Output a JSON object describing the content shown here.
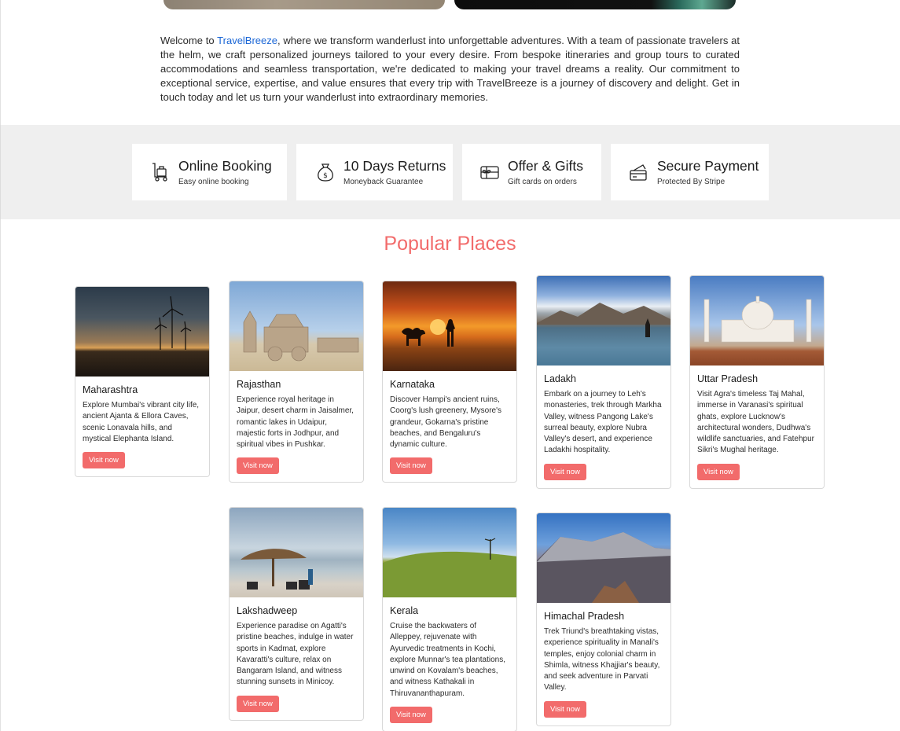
{
  "intro": {
    "prefix": "Welcome to ",
    "brand_link": "TravelBreeze",
    "text": ", where we transform wanderlust into unforgettable adventures. With a team of passionate travelers at the helm, we craft personalized journeys tailored to your every desire. From bespoke itineraries and group tours to curated accommodations and seamless transportation, we're dedicated to making your travel dreams a reality. Our commitment to exceptional service, expertise, and value ensures that every trip with TravelBreeze is a journey of discovery and delight. Get in touch today and let us turn your wanderlust into extraordinary memories."
  },
  "features": [
    {
      "title": "Online Booking",
      "subtitle": "Easy online booking",
      "icon": "luggage-trolley-icon"
    },
    {
      "title": "10 Days Returns",
      "subtitle": "Moneyback Guarantee",
      "icon": "money-bag-icon"
    },
    {
      "title": "Offer & Gifts",
      "subtitle": "Gift cards on orders",
      "icon": "gift-card-icon"
    },
    {
      "title": "Secure Payment",
      "subtitle": "Protected By Stripe",
      "icon": "credit-card-icon"
    }
  ],
  "popular": {
    "title": "Popular Places",
    "button_label": "Visit now",
    "places": [
      {
        "name": "Maharashtra",
        "desc": "Explore Mumbai's vibrant city life, ancient Ajanta & Ellora Caves, scenic Lonavala hills, and mystical Elephanta Island."
      },
      {
        "name": "Rajasthan",
        "desc": "Experience royal heritage in Jaipur, desert charm in Jaisalmer, romantic lakes in Udaipur, majestic forts in Jodhpur, and spiritual vibes in Pushkar."
      },
      {
        "name": "Karnataka",
        "desc": "Discover Hampi's ancient ruins, Coorg's lush greenery, Mysore's grandeur, Gokarna's pristine beaches, and Bengaluru's dynamic culture."
      },
      {
        "name": "Ladakh",
        "desc": "Embark on a journey to Leh's monasteries, trek through Markha Valley, witness Pangong Lake's surreal beauty, explore Nubra Valley's desert, and experience Ladakhi hospitality."
      },
      {
        "name": "Uttar Pradesh",
        "desc": "Visit Agra's timeless Taj Mahal, immerse in Varanasi's spiritual ghats, explore Lucknow's architectural wonders, Dudhwa's wildlife sanctuaries, and Fatehpur Sikri's Mughal heritage."
      },
      {
        "name": "Lakshadweep",
        "desc": "Experience paradise on Agatti's pristine beaches, indulge in water sports in Kadmat, explore Kavaratti's culture, relax on Bangaram Island, and witness stunning sunsets in Minicoy."
      },
      {
        "name": "Kerala",
        "desc": "Cruise the backwaters of Alleppey, rejuvenate with Ayurvedic treatments in Kochi, explore Munnar's tea plantations, unwind on Kovalam's beaches, and witness Kathakali in Thiruvananthapuram."
      },
      {
        "name": "Himachal Pradesh",
        "desc": "Trek Triund's breathtaking vistas, experience spirituality in Manali's temples, enjoy colonial charm in Shimla, witness Khajjiar's beauty, and seek adventure in Parvati Valley."
      }
    ]
  },
  "colors": {
    "accent": "#f26b6b",
    "link": "#1a66d6",
    "band": "#efefef"
  }
}
